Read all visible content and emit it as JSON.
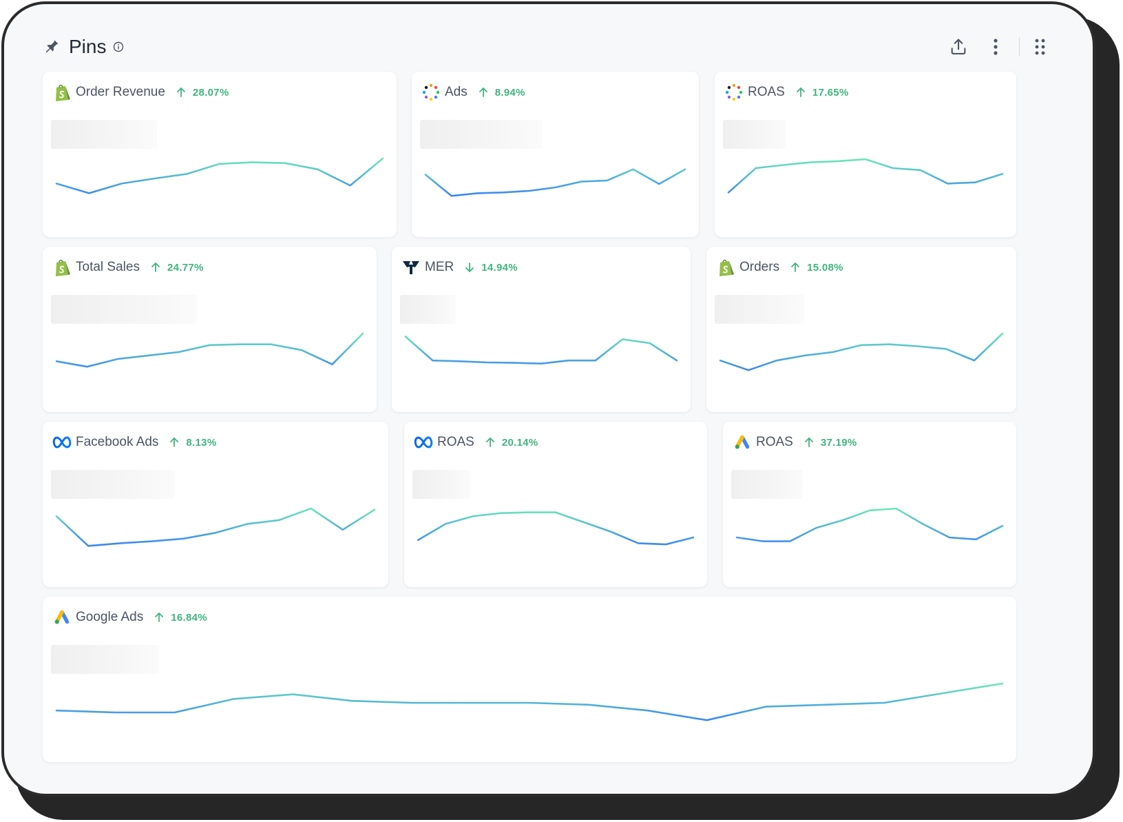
{
  "header": {
    "title": "Pins",
    "icons": {
      "pin": "pin-icon",
      "info": "info-icon",
      "export": "upload-icon",
      "more": "more-vertical-icon",
      "apps": "grid-icon"
    }
  },
  "colors": {
    "trend_green": "#3fb57d",
    "line_start": "#3b82f6",
    "line_end": "#6ee7b7"
  },
  "cards": [
    {
      "source": "shopify-icon",
      "title": "Order Revenue",
      "trend": "up",
      "pct": "28.07%",
      "series": [
        0.35,
        0.1,
        0.35,
        0.48,
        0.6,
        0.86,
        0.9,
        0.88,
        0.72,
        0.3,
        1.0
      ]
    },
    {
      "source": "dots-icon",
      "title": "Ads",
      "trend": "up",
      "pct": "8.94%",
      "series": [
        0.58,
        0.03,
        0.1,
        0.12,
        0.16,
        0.25,
        0.4,
        0.43,
        0.72,
        0.34,
        0.72
      ]
    },
    {
      "source": "dots-icon",
      "title": "ROAS",
      "trend": "up",
      "pct": "17.65%",
      "series": [
        0.12,
        0.75,
        0.83,
        0.9,
        0.93,
        0.98,
        0.75,
        0.7,
        0.35,
        0.38,
        0.6
      ]
    },
    {
      "source": "shopify-icon",
      "title": "Total Sales",
      "trend": "up",
      "pct": "24.77%",
      "series": [
        0.28,
        0.14,
        0.34,
        0.43,
        0.52,
        0.7,
        0.72,
        0.72,
        0.57,
        0.2,
        1.0
      ]
    },
    {
      "source": "tw-icon",
      "title": "MER",
      "trend": "down",
      "pct": "14.94%",
      "series": [
        0.92,
        0.3,
        0.28,
        0.25,
        0.24,
        0.22,
        0.3,
        0.3,
        0.85,
        0.75,
        0.3
      ]
    },
    {
      "source": "shopify-icon",
      "title": "Orders",
      "trend": "up",
      "pct": "15.08%",
      "series": [
        0.3,
        0.05,
        0.3,
        0.43,
        0.52,
        0.7,
        0.72,
        0.67,
        0.6,
        0.3,
        1.0
      ]
    },
    {
      "source": "meta-icon",
      "title": "Facebook Ads",
      "trend": "up",
      "pct": "8.13%",
      "series": [
        0.8,
        0.03,
        0.1,
        0.15,
        0.22,
        0.37,
        0.6,
        0.7,
        1.0,
        0.45,
        0.97
      ]
    },
    {
      "source": "meta-icon",
      "title": "ROAS",
      "trend": "up",
      "pct": "20.14%",
      "series": [
        0.18,
        0.6,
        0.8,
        0.88,
        0.9,
        0.9,
        0.65,
        0.4,
        0.1,
        0.07,
        0.25
      ]
    },
    {
      "source": "google-ads-icon",
      "title": "ROAS",
      "trend": "up",
      "pct": "37.19%",
      "series": [
        0.25,
        0.15,
        0.15,
        0.5,
        0.7,
        0.95,
        1.0,
        0.6,
        0.25,
        0.2,
        0.55
      ]
    },
    {
      "source": "google-ads-icon",
      "title": "Google Ads",
      "trend": "up",
      "pct": "16.84%",
      "series": [
        0.3,
        0.25,
        0.25,
        0.6,
        0.72,
        0.55,
        0.5,
        0.5,
        0.5,
        0.45,
        0.3,
        0.05,
        0.4,
        0.45,
        0.5,
        0.75,
        1.0
      ]
    }
  ]
}
